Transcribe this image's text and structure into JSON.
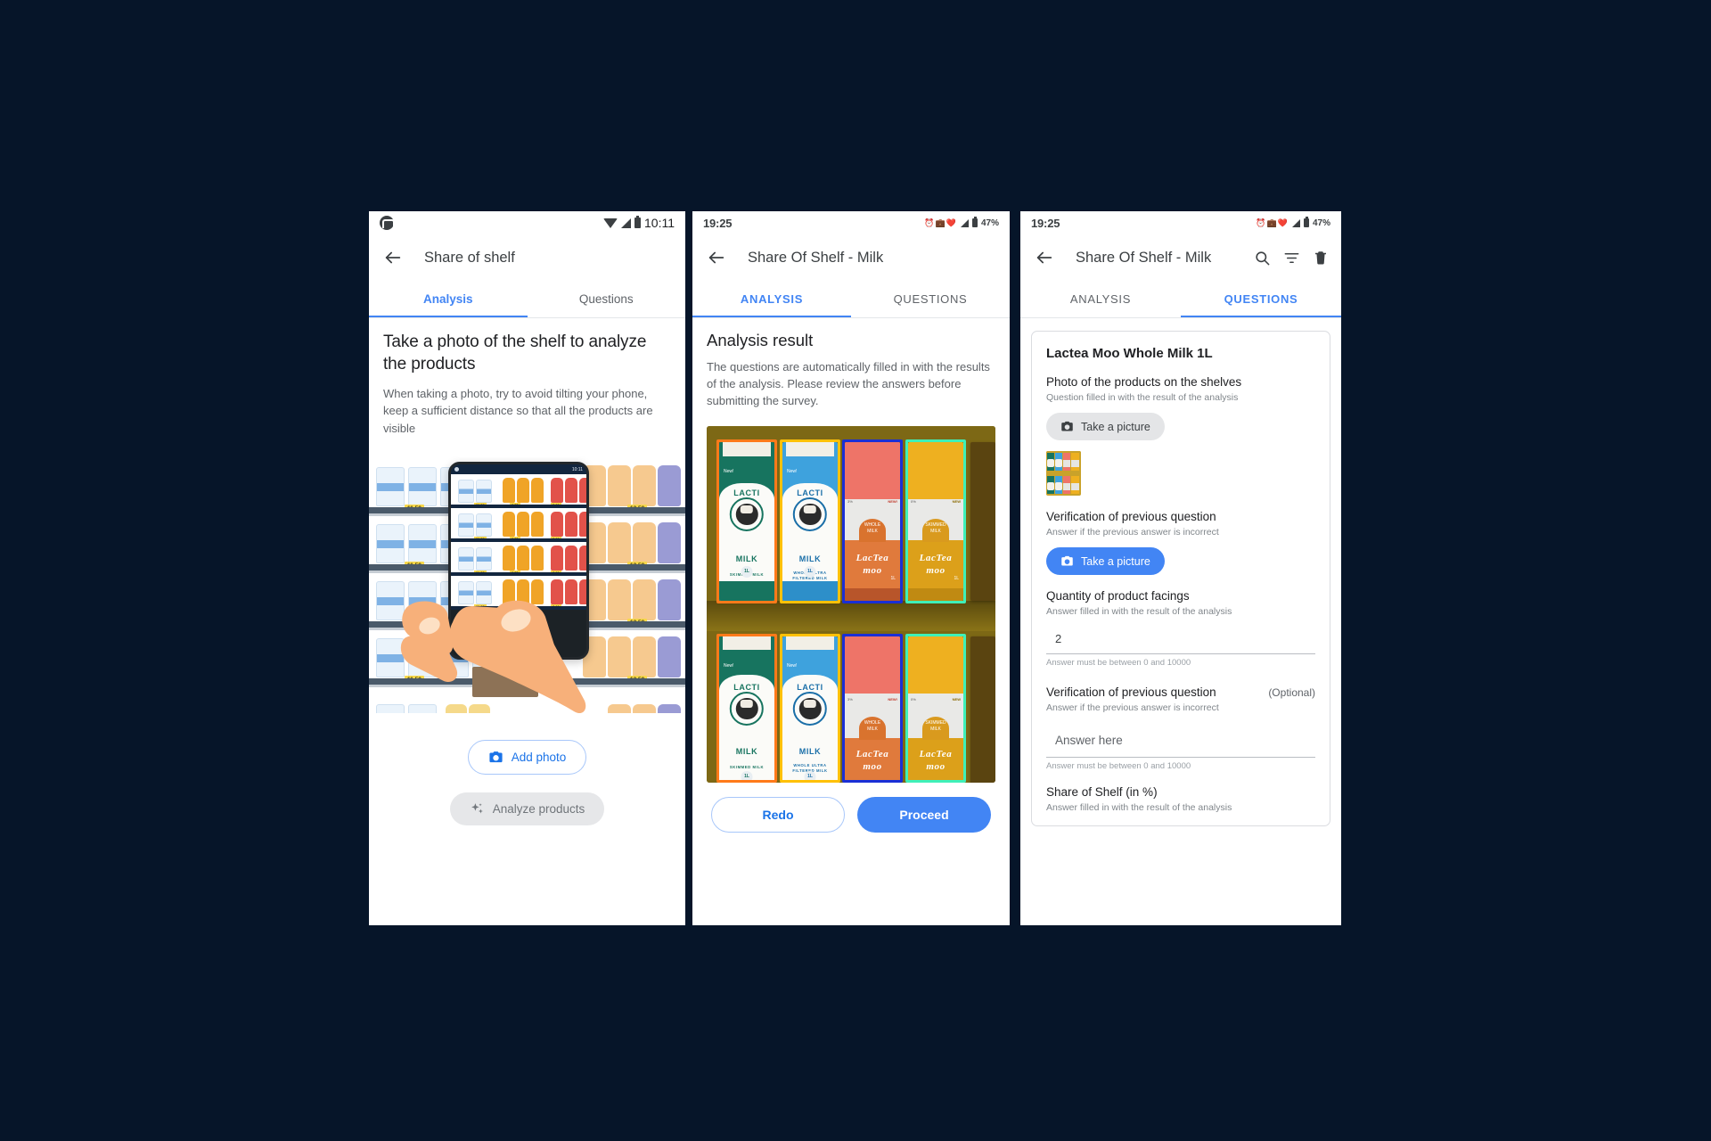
{
  "panel1": {
    "name": "share-of-shelf-analysis-empty",
    "status_bar": {
      "time": "10:11",
      "logo": "motorola-logo",
      "icons": [
        "wifi-icon",
        "signal-icon",
        "battery-icon"
      ]
    },
    "appbar": {
      "back_icon": "back-arrow-icon",
      "title": "Share of shelf"
    },
    "tabs": [
      {
        "label": "Analysis",
        "active": true
      },
      {
        "label": "Questions",
        "active": false
      }
    ],
    "heading": "Take a photo of the shelf to analyze the products",
    "subtext": "When taking a photo, try to avoid tilting your phone, keep a sufficient distance so that all the products are visible",
    "illustration": {
      "name": "shelf-photo-illustration",
      "phone_status_time": "10:11",
      "shelf_prices": [
        "11.50",
        "12.50",
        "11.50",
        "12.50",
        "11.50",
        "12.50",
        "11.50",
        "9.50",
        "12.50"
      ],
      "inphone_prices": [
        "11.50",
        "9.50",
        "8.90"
      ]
    },
    "buttons": {
      "add_photo": {
        "label": "Add photo",
        "icon": "camera-icon",
        "state": "enabled"
      },
      "analyze": {
        "label": "Analyze products",
        "icon": "sparkle-icon",
        "state": "disabled"
      }
    }
  },
  "panel2": {
    "name": "share-of-shelf-analysis-result",
    "status_bar": {
      "time": "19:25",
      "battery": "47%",
      "icons": [
        "alarm-icon",
        "briefcase-icon",
        "bluetooth-icon",
        "4g-icon",
        "signal-icon",
        "battery-icon"
      ]
    },
    "appbar": {
      "back_icon": "back-arrow-icon",
      "title": "Share Of Shelf - Milk"
    },
    "tabs": [
      {
        "label": "ANALYSIS",
        "active": true
      },
      {
        "label": "QUESTIONS",
        "active": false
      }
    ],
    "heading": "Analysis result",
    "subtext": "The questions are automatically filled in with the results of the analysis. Please review the answers before submitting the survey.",
    "photo": {
      "name": "analysis-photo-with-detections",
      "detections": [
        {
          "label": "LACTI MILK SKIMMED MILK",
          "box_color": "#ff7a1a",
          "body_color": "#17745f"
        },
        {
          "label": "LACTI MILK WHOLE ULTRA FILTERED MILK",
          "box_color": "#ffc107",
          "body_color": "#3ea2dd"
        },
        {
          "label": "LacTea moo WHOLE MILK",
          "box_color": "#1a2fd6",
          "body_color": "#ee7468"
        },
        {
          "label": "LacTea moo SKIMMED MILK",
          "box_color": "#3ff0b8",
          "body_color": "#eeb020"
        }
      ],
      "carton_texts": {
        "brand": "LACTI",
        "brand2": "MILK",
        "variant1": "SKIMMED MILK",
        "variant2": "WHOLE ULTRA FILTERED MILK",
        "size": "1L",
        "moo_brand": "LacTea",
        "moo_brand2": "moo",
        "moo_variant1": "WHOLE MILK",
        "moo_variant2": "SKIMMED MILK",
        "badge": "NEW"
      }
    },
    "buttons": {
      "redo": "Redo",
      "proceed": "Proceed"
    }
  },
  "panel3": {
    "name": "share-of-shelf-questions",
    "status_bar": {
      "time": "19:25",
      "battery": "47%"
    },
    "appbar": {
      "back_icon": "back-arrow-icon",
      "title": "Share Of Shelf - Milk",
      "actions": [
        "search-icon",
        "filter-icon",
        "delete-icon"
      ]
    },
    "tabs": [
      {
        "label": "ANALYSIS",
        "active": false
      },
      {
        "label": "QUESTIONS",
        "active": true
      }
    ],
    "card_title": "Lactea Moo Whole Milk 1L",
    "questions": [
      {
        "label": "Photo of the products on the shelves",
        "help": "Question filled in with the result of the analysis",
        "button": {
          "label": "Take a picture",
          "icon": "camera-icon",
          "style": "grey"
        },
        "thumbnail": "shelf-photo-thumbnail"
      },
      {
        "label": "Verification of previous question",
        "help": "Answer if the previous answer is incorrect",
        "button": {
          "label": "Take a picture",
          "icon": "camera-icon",
          "style": "blue"
        }
      },
      {
        "label": "Quantity of product facings",
        "help": "Answer filled in with the result of the analysis",
        "value": "2",
        "note": "Answer must be between 0 and 10000"
      },
      {
        "label": "Verification of previous question",
        "optional": "(Optional)",
        "help": "Answer if the previous answer is incorrect",
        "placeholder": "Answer here",
        "note": "Answer must be between 0 and 10000"
      },
      {
        "label": "Share of Shelf (in %)",
        "help": "Answer filled in with the result of the analysis"
      }
    ]
  },
  "colors": {
    "accent": "#4285f4",
    "link": "#1a73e8",
    "text_primary": "#202124",
    "text_secondary": "#5f6368",
    "background": "#061529"
  }
}
